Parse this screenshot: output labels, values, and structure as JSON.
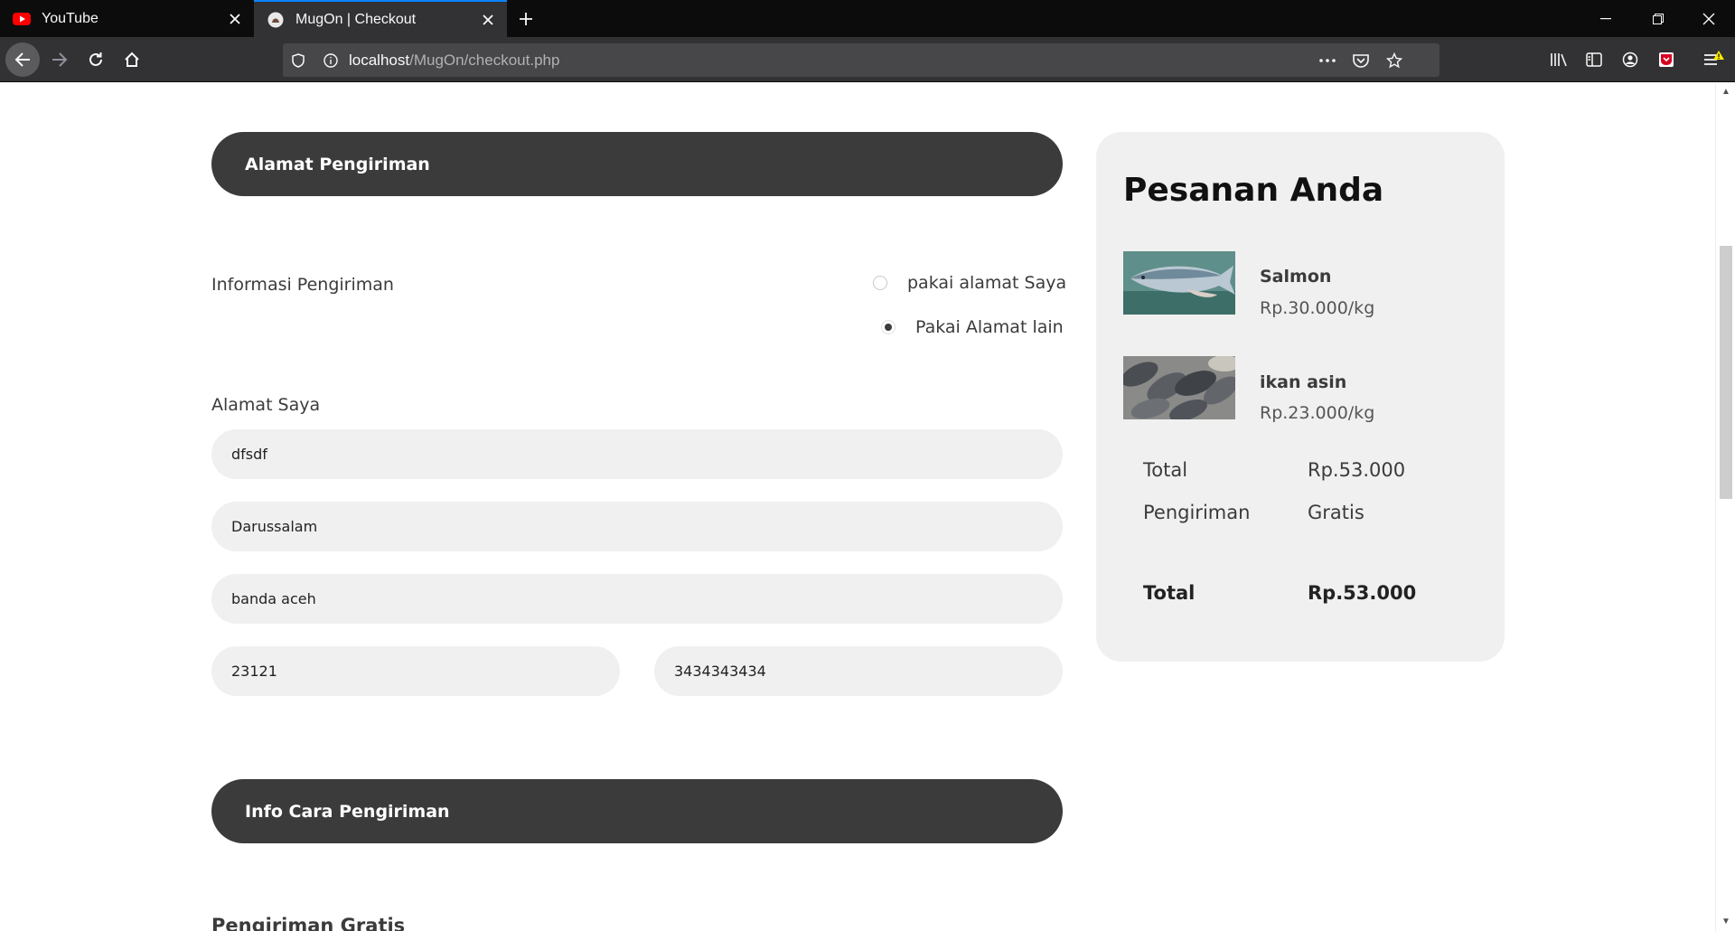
{
  "browser": {
    "tabs": [
      {
        "title": "YouTube",
        "favicon": "youtube-icon",
        "active": false
      },
      {
        "title": "MugOn | Checkout",
        "favicon": "mugon-icon",
        "active": true
      }
    ],
    "url_host": "localhost",
    "url_path": "/MugOn/checkout.php",
    "accent_color": "#0a84ff"
  },
  "shipping": {
    "header": "Alamat Pengiriman",
    "info_label": "Informasi Pengiriman",
    "radio_options": [
      {
        "label": "pakai alamat Saya",
        "checked": false
      },
      {
        "label": "Pakai Alamat lain",
        "checked": true
      }
    ],
    "address_label": "Alamat Saya",
    "fields": {
      "address": "dfsdf",
      "district": "Darussalam",
      "city": "banda aceh",
      "postal_code": "23121",
      "phone": "3434343434"
    }
  },
  "delivery": {
    "header": "Info Cara Pengiriman",
    "method_label": "Pengiriman Gratis"
  },
  "order": {
    "title": "Pesanan Anda",
    "items": [
      {
        "name": "Salmon",
        "price": "Rp.30.000/kg",
        "image": "salmon-photo"
      },
      {
        "name": "ikan asin",
        "price": "Rp.23.000/kg",
        "image": "salted-fish-photo"
      }
    ],
    "subtotal_label": "Total",
    "subtotal_value": "Rp.53.000",
    "shipping_label": "Pengiriman",
    "shipping_value": "Gratis",
    "total_label": "Total",
    "total_value": "Rp.53.000"
  },
  "colors": {
    "header_bg": "#3b3b3b",
    "field_bg": "#f0f0f0",
    "card_bg": "#f0f0f0"
  }
}
